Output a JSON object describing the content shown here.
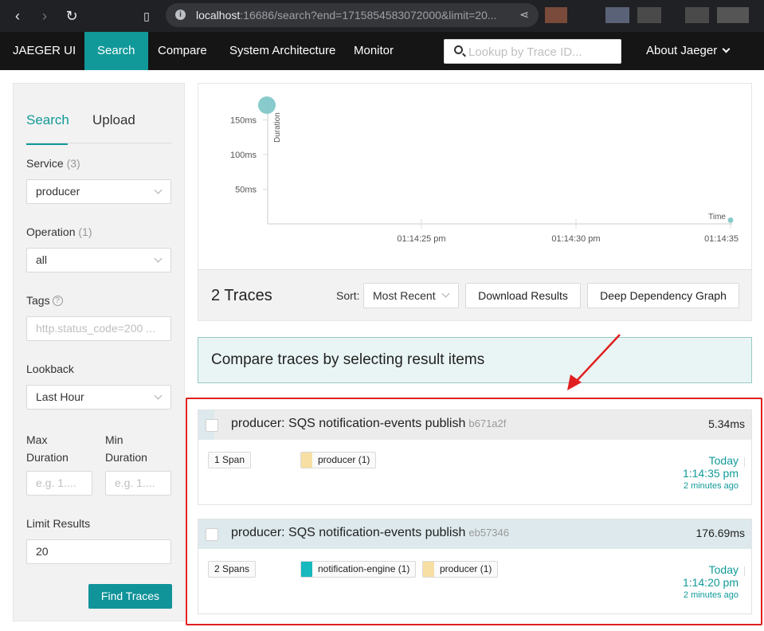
{
  "browser": {
    "url_host": "localhost",
    "url_rest": ":16686/search?end=1715854583072000&limit=20..."
  },
  "topbar": {
    "brand": "JAEGER UI",
    "nav": [
      "Search",
      "Compare",
      "System Architecture",
      "Monitor"
    ],
    "lookup_placeholder": "Lookup by Trace ID...",
    "about": "About Jaeger"
  },
  "sidebar": {
    "tabs": [
      "Search",
      "Upload"
    ],
    "service_label": "Service",
    "service_count": "(3)",
    "service_value": "producer",
    "operation_label": "Operation",
    "operation_count": "(1)",
    "operation_value": "all",
    "tags_label": "Tags",
    "tags_placeholder": "http.status_code=200 ...",
    "lookback_label": "Lookback",
    "lookback_value": "Last Hour",
    "max_label_1": "Max",
    "max_label_2": "Duration",
    "max_placeholder": "e.g. 1....",
    "min_label_1": "Min",
    "min_label_2": "Duration",
    "min_placeholder": "e.g. 1....",
    "limit_label": "Limit Results",
    "limit_value": "20",
    "find_button": "Find Traces"
  },
  "chart_data": {
    "type": "scatter",
    "ylabel": "Duration",
    "xlabel": "Time",
    "yticks": [
      "150ms",
      "100ms",
      "50ms"
    ],
    "xticks": [
      "01:14:25 pm",
      "01:14:30 pm",
      "01:14:35"
    ],
    "points": [
      {
        "time": "01:14:20 pm",
        "duration_ms": 176.69
      },
      {
        "time": "01:14:35 pm",
        "duration_ms": 5.34
      }
    ]
  },
  "results": {
    "count": "2 Traces",
    "sort_label": "Sort:",
    "sort_value": "Most Recent",
    "download": "Download Results",
    "ddg": "Deep Dependency Graph"
  },
  "compare_banner": "Compare traces by selecting result items",
  "traces": [
    {
      "title": "producer: SQS notification-events publish",
      "trace_id": "b671a2f",
      "duration": "5.34ms",
      "spans": "1 Span",
      "services": [
        {
          "name": "producer (1)",
          "color": "#f7dfa3"
        }
      ],
      "day": "Today",
      "time": "1:14:35 pm",
      "ago": "2 minutes ago"
    },
    {
      "title": "producer: SQS notification-events publish",
      "trace_id": "eb57346",
      "duration": "176.69ms",
      "spans": "2 Spans",
      "services": [
        {
          "name": "notification-engine (1)",
          "color": "#17b8be"
        },
        {
          "name": "producer (1)",
          "color": "#f7dfa3"
        }
      ],
      "day": "Today",
      "time": "1:14:20 pm",
      "ago": "2 minutes ago"
    }
  ]
}
